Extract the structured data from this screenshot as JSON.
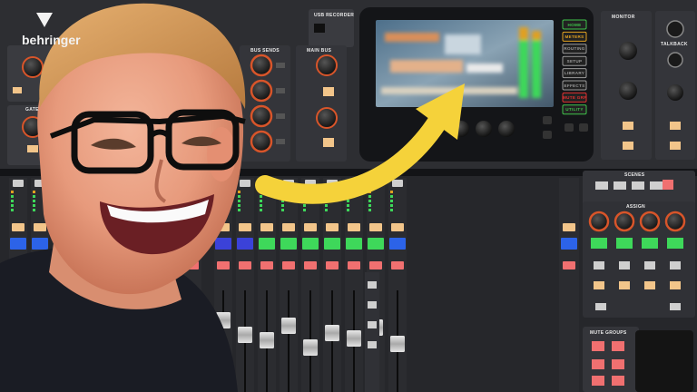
{
  "console": {
    "brand": "behringer",
    "sections": {
      "usb_recorder": "USB RECORDER",
      "bus_sends": "BUS SENDS",
      "main_bus": "MAIN BUS",
      "monitor": "MONITOR",
      "talkback": "TALKBACK",
      "gate": "GATE",
      "scenes": "SCENES",
      "assign": "ASSIGN",
      "mute_groups": "MUTE GROUPS"
    },
    "screen_buttons": [
      {
        "label": "HOME",
        "color": "#3fc24a"
      },
      {
        "label": "METERS",
        "color": "#e0a020"
      },
      {
        "label": "ROUTING",
        "color": "#9a9a9a"
      },
      {
        "label": "SETUP",
        "color": "#9a9a9a"
      },
      {
        "label": "LIBRARY",
        "color": "#9a9a9a"
      },
      {
        "label": "EFFECTS",
        "color": "#9a9a9a"
      },
      {
        "label": "MUTE GRP",
        "color": "#e03030"
      },
      {
        "label": "UTILITY",
        "color": "#3fc24a"
      }
    ],
    "colors": {
      "panel": "#2a2b2f",
      "panel_dark": "#151619",
      "knob_ring": "#d8552a",
      "button_warm": "#f2c58a",
      "mute_red": "#f07070",
      "lcd_blue": "#2c63e8",
      "lcd_green": "#3ed85a"
    }
  },
  "overlay": {
    "arrow_color": "#f5d23a"
  }
}
